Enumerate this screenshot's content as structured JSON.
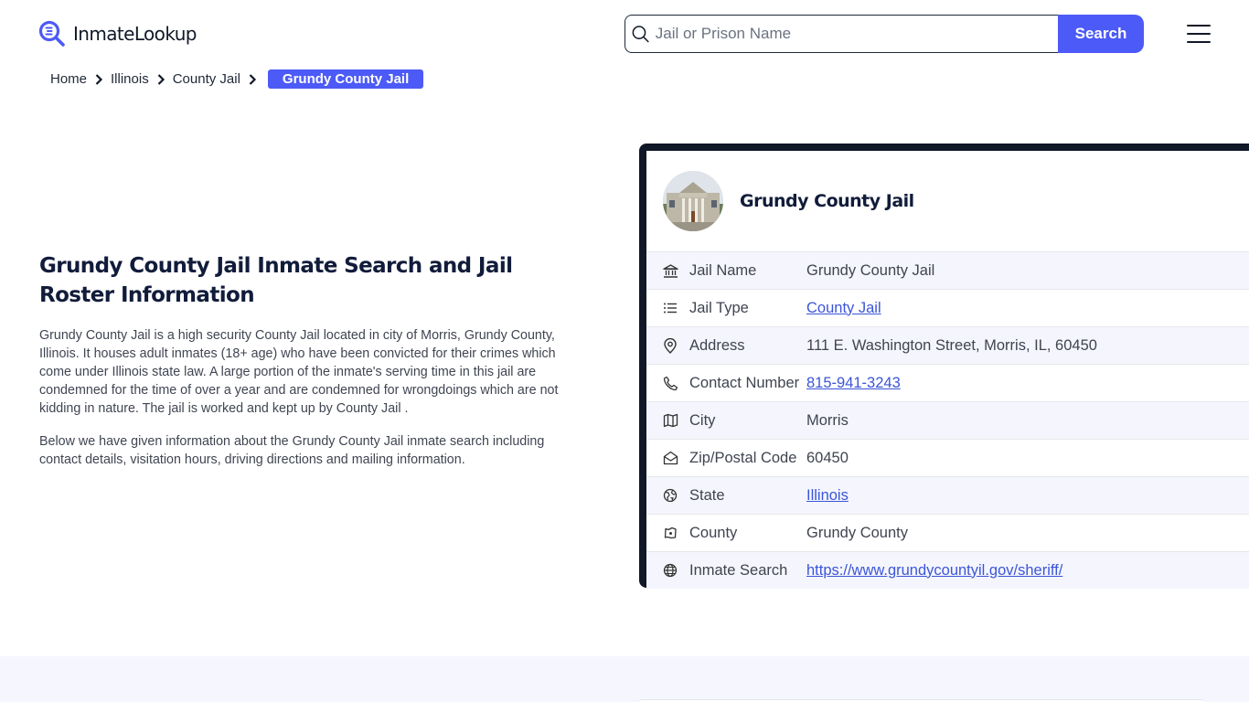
{
  "header": {
    "logo_text": "InmateLookup",
    "search_placeholder": "Jail or Prison Name",
    "search_value": "",
    "search_button": "Search",
    "menu_icon": "hamburger-icon"
  },
  "breadcrumb": {
    "items": [
      "Home",
      "Illinois",
      "County Jail"
    ],
    "current": "Grundy County Jail"
  },
  "intro": {
    "title": "Grundy County Jail Inmate Search and Jail Roster Information",
    "paragraphs": [
      "Grundy County Jail is a high security County Jail located in city of Morris, Grundy County, Illinois. It houses adult inmates (18+ age) who have been convicted for their crimes which come under Illinois state law. A large portion of the inmate's serving time in this jail are condemned for the time of over a year and are condemned for wrongdoings which are not kidding in nature. The jail is worked and kept up by County Jail .",
      "Below we have given information about the Grundy County Jail inmate search including contact details, visitation hours, driving directions and mailing information."
    ]
  },
  "card": {
    "title": "Grundy County Jail",
    "image_alt": "courthouse-photo",
    "rows": [
      {
        "icon": "building-icon",
        "label": "Jail Name",
        "value": "Grundy County Jail",
        "link": false
      },
      {
        "icon": "list-icon",
        "label": "Jail Type",
        "value": "County Jail",
        "link": true
      },
      {
        "icon": "map-pin-icon",
        "label": "Address",
        "value": "111 E. Washington Street, Morris, IL, 60450",
        "link": false
      },
      {
        "icon": "phone-icon",
        "label": "Contact Number",
        "value": "815-941-3243",
        "link": true
      },
      {
        "icon": "map-icon",
        "label": "City",
        "value": "Morris",
        "link": false
      },
      {
        "icon": "envelope-icon",
        "label": "Zip/Postal Code",
        "value": "60450",
        "link": false
      },
      {
        "icon": "globe-region-icon",
        "label": "State",
        "value": "Illinois",
        "link": true
      },
      {
        "icon": "county-map-icon",
        "label": "County",
        "value": "Grundy County",
        "link": false
      },
      {
        "icon": "globe-icon",
        "label": "Inmate Search",
        "value": "https://www.grundycountyil.gov/sheriff/",
        "link": true
      }
    ]
  },
  "colors": {
    "accent": "#4c5af7",
    "card_border": "#111827",
    "link": "#3b55d9",
    "row_alt_bg": "#f5f6fd"
  }
}
